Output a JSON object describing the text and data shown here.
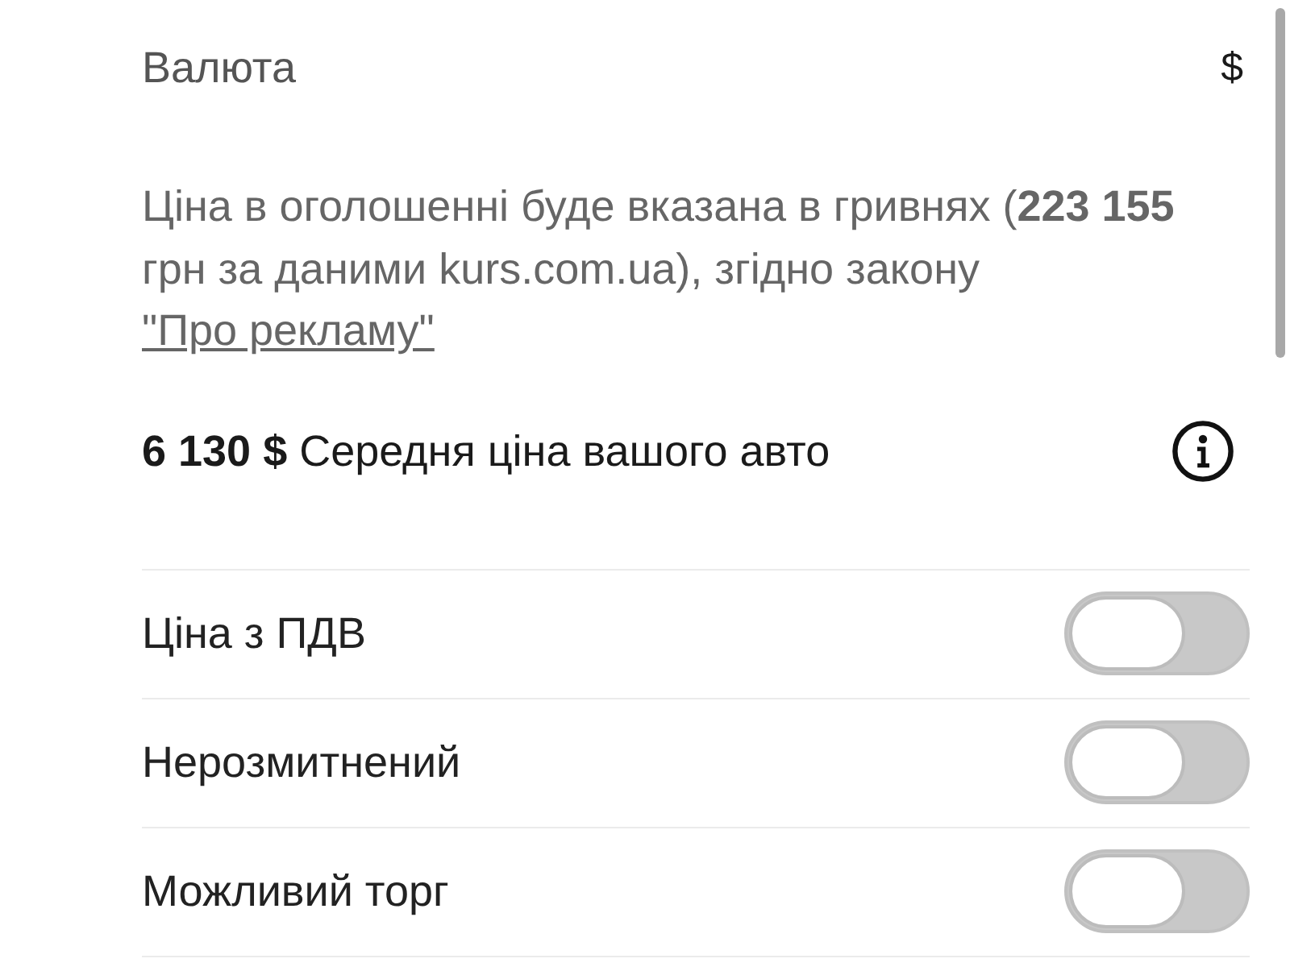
{
  "currency": {
    "label": "Валюта",
    "value": "$"
  },
  "notice": {
    "text": "Ціна в оголошенні буде вказана в гривнях (**223 155** грн за даними kurs.com.ua), згідно закону ",
    "link": "\"Про рекламу\""
  },
  "average_price": {
    "text": "**6 130 $** Середня ціна вашого авто"
  },
  "options": [
    {
      "label": "Ціна з ПДВ",
      "on": false
    },
    {
      "label": "Нерозмитнений",
      "on": false
    },
    {
      "label": "Можливий торг",
      "on": false
    }
  ]
}
